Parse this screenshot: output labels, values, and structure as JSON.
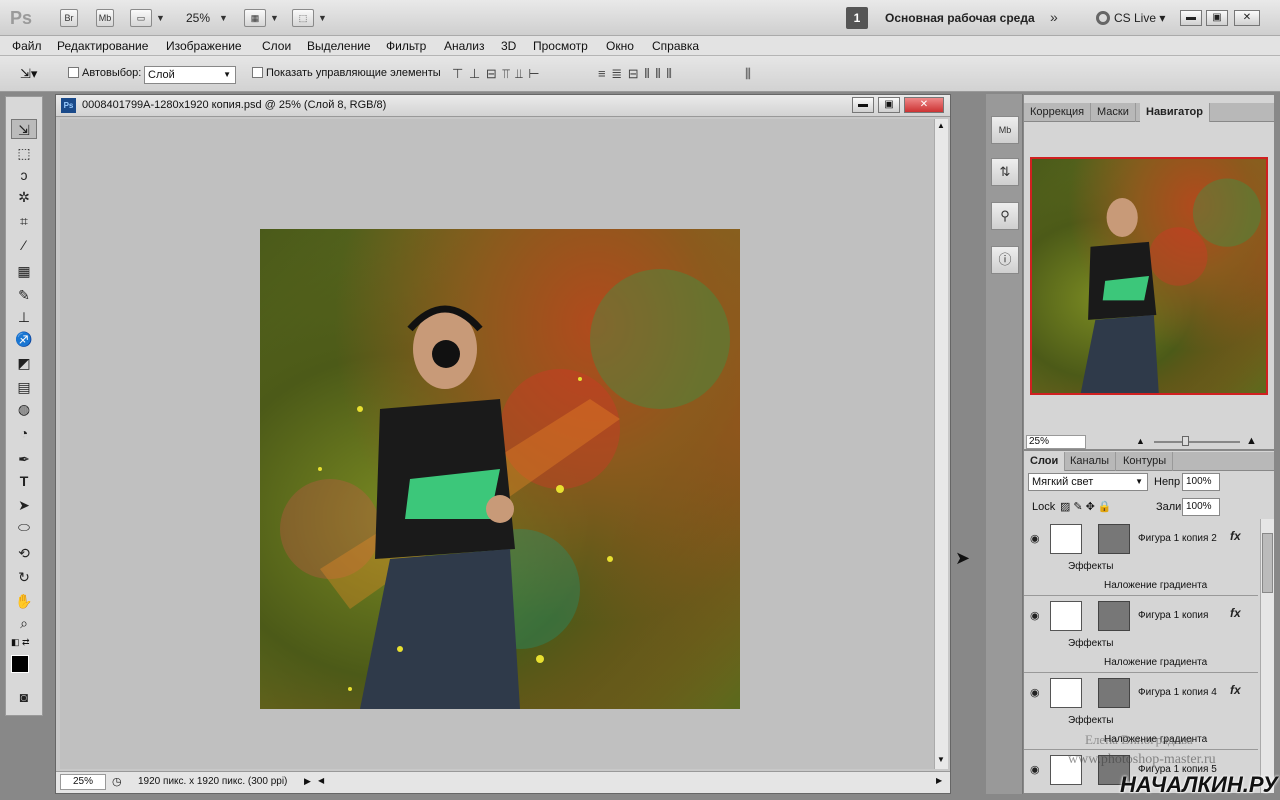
{
  "app": {
    "logo": "Ps",
    "bridge": "Br",
    "mini_bridge": "Mb",
    "zoom": "25%",
    "workspace_number": "1",
    "workspace_name": "Основная рабочая среда",
    "cs_live": "CS Live"
  },
  "menu": [
    "Файл",
    "Редактирование",
    "Изображение",
    "Слои",
    "Выделение",
    "Фильтр",
    "Анализ",
    "3D",
    "Просмотр",
    "Окно",
    "Справка"
  ],
  "options": {
    "auto_select_label": "Автовыбор:",
    "auto_select_value": "Слой",
    "show_controls_label": "Показать управляющие элементы"
  },
  "document": {
    "title": "0008401799A-1280x1920 копия.psd @ 25% (Слой 8, RGB/8)",
    "status_zoom": "25%",
    "status_info": "1920 пикс. x 1920 пикс. (300 ppi)"
  },
  "panels": {
    "top_tabs": [
      "Коррекция",
      "Маски",
      "Навигатор"
    ],
    "nav_zoom": "25%",
    "layer_tabs": [
      "Слои",
      "Каналы",
      "Контуры"
    ],
    "blend_mode": "Мягкий свет",
    "opacity_label": "Непр",
    "opacity": "100%",
    "lock_label": "Lock",
    "fill_label": "Заливка",
    "fill": "100%"
  },
  "layers": [
    {
      "name": "Фигура 1 копия 2",
      "effects": "Эффекты",
      "effect": "Наложение градиента"
    },
    {
      "name": "Фигура 1 копия",
      "effects": "Эффекты",
      "effect": "Наложение градиента"
    },
    {
      "name": "Фигура 1 копия 4",
      "effects": "Эффекты",
      "effect": "Наложение градиента"
    },
    {
      "name": "Фигура 1 копия 5"
    }
  ],
  "watermarks": {
    "author": "Елена Виноградова",
    "site": "www.photoshop-master.ru",
    "brand": "НАЧАЛКИН.РУ"
  }
}
